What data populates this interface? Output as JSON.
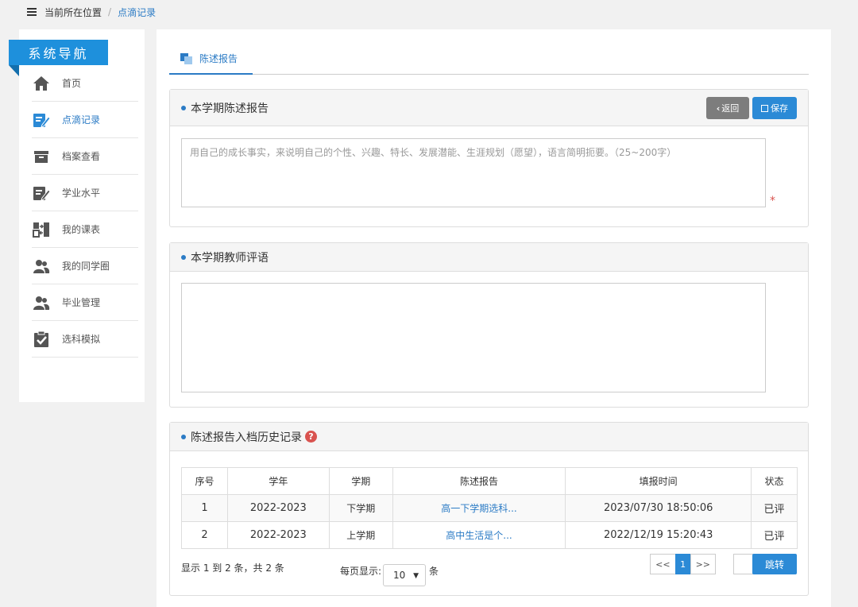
{
  "breadcrumb": {
    "menu_icon": "hamburger-icon",
    "location_label": "当前所在位置",
    "separator": "/",
    "current": "点滴记录"
  },
  "sidebar": {
    "title": "系统导航",
    "items": [
      {
        "label": "首页",
        "icon": "home-icon"
      },
      {
        "label": "点滴记录",
        "icon": "edit-icon",
        "active": true
      },
      {
        "label": "档案查看",
        "icon": "archive-icon"
      },
      {
        "label": "学业水平",
        "icon": "document-edit-icon"
      },
      {
        "label": "我的课表",
        "icon": "schedule-icon"
      },
      {
        "label": "我的同学圈",
        "icon": "users-icon"
      },
      {
        "label": "毕业管理",
        "icon": "graduation-users-icon"
      },
      {
        "label": "选科模拟",
        "icon": "clipboard-check-icon"
      }
    ]
  },
  "tabs": [
    {
      "label": "陈述报告",
      "active": true
    }
  ],
  "report_panel": {
    "title": "本学期陈述报告",
    "back_label": "返回",
    "save_label": "保存",
    "placeholder": "用自己的成长事实，来说明自己的个性、兴趣、特长、发展潜能、生涯规划（愿望），语言简明扼要。（25~200字）",
    "required_mark": "*"
  },
  "teacher_panel": {
    "title": "本学期教师评语"
  },
  "history_panel": {
    "title": "陈述报告入档历史记录",
    "help_icon": "?",
    "columns": [
      "序号",
      "学年",
      "学期",
      "陈述报告",
      "填报时间",
      "状态"
    ],
    "rows": [
      {
        "no": "1",
        "year": "2022-2023",
        "term": "下学期",
        "report": "高一下学期选科...",
        "time": "2023/07/30 18:50:06",
        "status": "已评"
      },
      {
        "no": "2",
        "year": "2022-2023",
        "term": "上学期",
        "report": "高中生活是个...",
        "time": "2022/12/19 15:20:43",
        "status": "已评"
      }
    ],
    "pager_info": "显示 1 到 2 条，共 2 条",
    "page_size_label": "每页显示:",
    "page_size_value": "10",
    "page_size_unit": "条",
    "prev_label": "<<",
    "current_page": "1",
    "next_label": ">>",
    "jump_label": "跳转"
  }
}
